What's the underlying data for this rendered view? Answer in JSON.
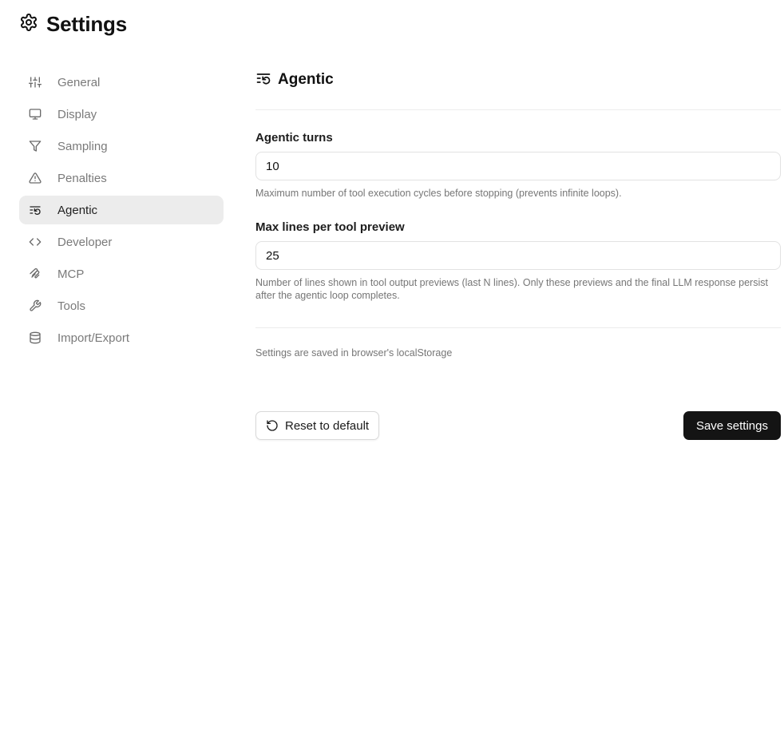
{
  "header": {
    "title": "Settings",
    "icon": "gear-icon"
  },
  "sidebar": {
    "items": [
      {
        "label": "General",
        "icon": "sliders-icon",
        "active": false
      },
      {
        "label": "Display",
        "icon": "monitor-icon",
        "active": false
      },
      {
        "label": "Sampling",
        "icon": "filter-icon",
        "active": false
      },
      {
        "label": "Penalties",
        "icon": "warning-triangle-icon",
        "active": false
      },
      {
        "label": "Agentic",
        "icon": "list-restart-icon",
        "active": true
      },
      {
        "label": "Developer",
        "icon": "code-icon",
        "active": false
      },
      {
        "label": "MCP",
        "icon": "mcp-icon",
        "active": false
      },
      {
        "label": "Tools",
        "icon": "tools-icon",
        "active": false
      },
      {
        "label": "Import/Export",
        "icon": "database-icon",
        "active": false
      }
    ]
  },
  "main": {
    "section_title": "Agentic",
    "section_icon": "list-restart-icon",
    "fields": [
      {
        "label": "Agentic turns",
        "value": "10",
        "hint": "Maximum number of tool execution cycles before stopping (prevents infinite loops)."
      },
      {
        "label": "Max lines per tool preview",
        "value": "25",
        "hint": "Number of lines shown in tool output previews (last N lines). Only these previews and the final LLM response persist after the agentic loop completes."
      }
    ],
    "storage_note": "Settings are saved in browser's localStorage"
  },
  "actions": {
    "reset_label": "Reset to default",
    "save_label": "Save settings"
  },
  "colors": {
    "active_bg": "#ececec",
    "primary_button": "#141414",
    "muted_text": "#767676"
  }
}
